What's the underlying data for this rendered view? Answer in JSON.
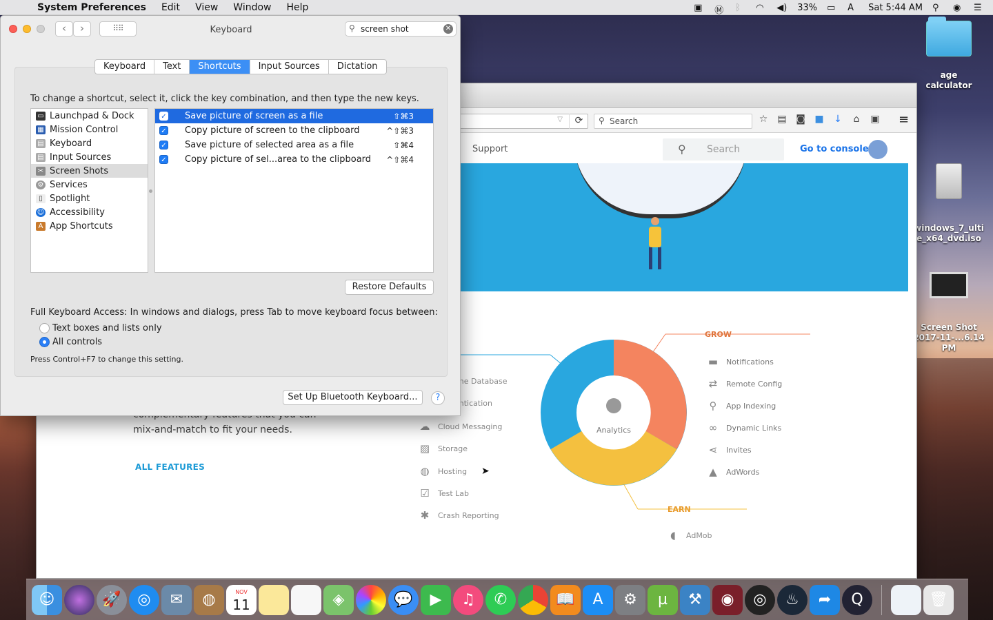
{
  "menubar": {
    "app_name": "System Preferences",
    "items": [
      "Edit",
      "View",
      "Window",
      "Help"
    ],
    "battery": "33%",
    "clock": "Sat 5:44 AM"
  },
  "desktop": {
    "icons": [
      {
        "label": "age calculator"
      },
      {
        "label": "windows_7_ulti\ne_x64_dvd.iso"
      },
      {
        "label": "Screen Shot\n2017-11-...6.14 PM"
      }
    ]
  },
  "browser": {
    "search_placeholder": "Search",
    "site": {
      "nav_support": "Support",
      "search_placeholder": "Search",
      "console_link": "Go to console",
      "features_text": "complementary features that you can mix-and-match to fit your needs.",
      "all_features": "ALL FEATURES",
      "diagram": {
        "center": "Analytics",
        "left_items": [
          "ime Database",
          "entication",
          "Cloud Messaging",
          "Storage",
          "Hosting",
          "Test Lab",
          "Crash Reporting"
        ],
        "grow_label": "GROW",
        "grow_items": [
          "Notifications",
          "Remote Config",
          "App Indexing",
          "Dynamic Links",
          "Invites",
          "AdWords"
        ],
        "earn_label": "EARN",
        "earn_items": [
          "AdMob"
        ],
        "colors": {
          "blue": "#29a7df",
          "orange": "#f4845f",
          "yellow": "#f4c03f"
        }
      }
    }
  },
  "prefs": {
    "title": "Keyboard",
    "search_value": "screen shot",
    "tabs": [
      {
        "label": "Keyboard",
        "active": false
      },
      {
        "label": "Text",
        "active": false
      },
      {
        "label": "Shortcuts",
        "active": true
      },
      {
        "label": "Input Sources",
        "active": false
      },
      {
        "label": "Dictation",
        "active": false
      }
    ],
    "instruction": "To change a shortcut, select it, click the key combination, and then type the new keys.",
    "categories": [
      {
        "label": "Launchpad & Dock",
        "selected": false
      },
      {
        "label": "Mission Control",
        "selected": false
      },
      {
        "label": "Keyboard",
        "selected": false
      },
      {
        "label": "Input Sources",
        "selected": false
      },
      {
        "label": "Screen Shots",
        "selected": true
      },
      {
        "label": "Services",
        "selected": false
      },
      {
        "label": "Spotlight",
        "selected": false
      },
      {
        "label": "Accessibility",
        "selected": false
      },
      {
        "label": "App Shortcuts",
        "selected": false
      }
    ],
    "shortcuts": [
      {
        "label": "Save picture of screen as a file",
        "keys": "⇧⌘3",
        "checked": true,
        "selected": true
      },
      {
        "label": "Copy picture of screen to the clipboard",
        "keys": "^⇧⌘3",
        "checked": true,
        "selected": false
      },
      {
        "label": "Save picture of selected area as a file",
        "keys": "⇧⌘4",
        "checked": true,
        "selected": false
      },
      {
        "label": "Copy picture of sel...area to the clipboard",
        "keys": "^⇧⌘4",
        "checked": true,
        "selected": false
      }
    ],
    "restore_defaults": "Restore Defaults",
    "full_keyboard_access": "Full Keyboard Access: In windows and dialogs, press Tab to move keyboard focus between:",
    "radio_options": [
      {
        "label": "Text boxes and lists only",
        "checked": false
      },
      {
        "label": "All controls",
        "checked": true
      }
    ],
    "control_note": "Press Control+F7 to change this setting.",
    "bluetooth_button": "Set Up Bluetooth Keyboard...",
    "help": "?"
  },
  "dock": {
    "calendar_month": "NOV",
    "calendar_day": "11"
  }
}
